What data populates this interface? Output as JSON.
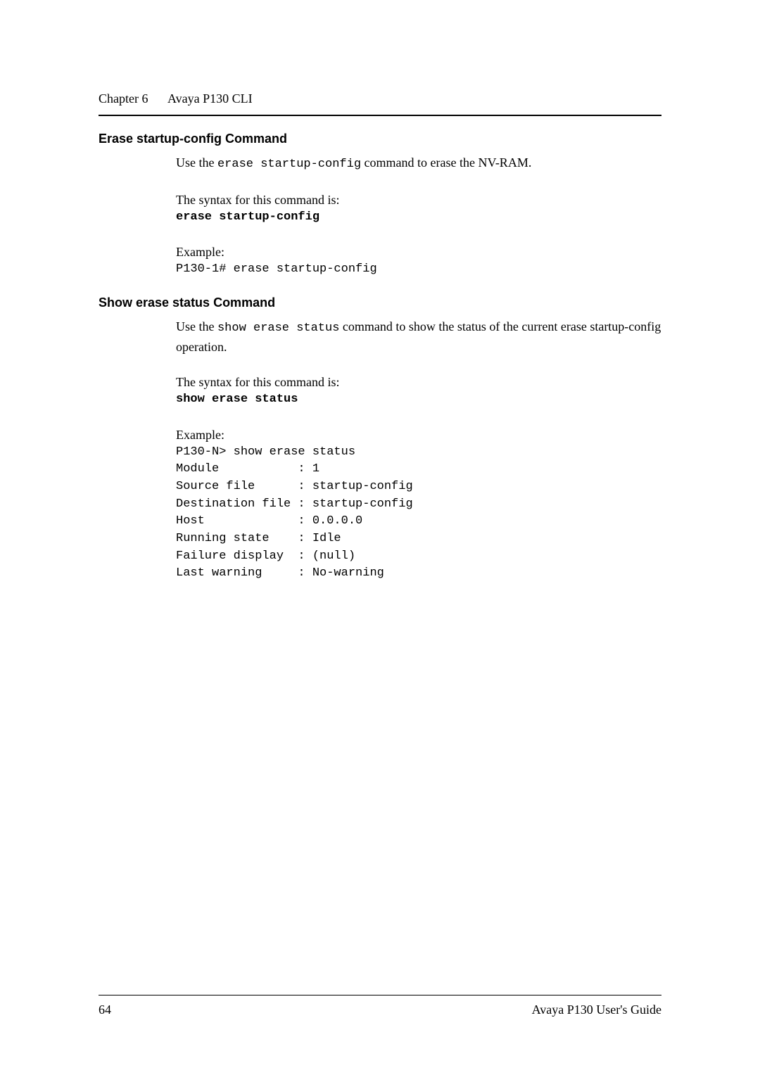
{
  "header": {
    "chapter_label": "Chapter 6",
    "chapter_title": "Avaya P130 CLI"
  },
  "sections": {
    "erase": {
      "heading": "Erase startup-config Command",
      "intro_pre": "Use the ",
      "intro_code": "erase startup-config",
      "intro_post": " command to erase the NV-RAM.",
      "syntax_label": "The syntax for this command is:",
      "syntax_cmd": "erase startup-config",
      "example_label": "Example:",
      "example_line": "P130-1# erase startup-config"
    },
    "show": {
      "heading": "Show erase status Command",
      "intro_pre": "Use the ",
      "intro_code": "show erase status",
      "intro_post": " command to show the status of the current erase startup-config operation.",
      "syntax_label": "The syntax for this command is:",
      "syntax_cmd": "show erase status",
      "example_label": "Example:",
      "example_lines": {
        "l0": "P130-N> show erase status",
        "l1": "Module           : 1",
        "l2": "Source file      : startup-config",
        "l3": "Destination file : startup-config",
        "l4": "Host             : 0.0.0.0",
        "l5": "Running state    : Idle",
        "l6": "Failure display  : (null)",
        "l7": "Last warning     : No-warning"
      }
    }
  },
  "footer": {
    "page_number": "64",
    "book_title": "Avaya P130 User's Guide"
  }
}
